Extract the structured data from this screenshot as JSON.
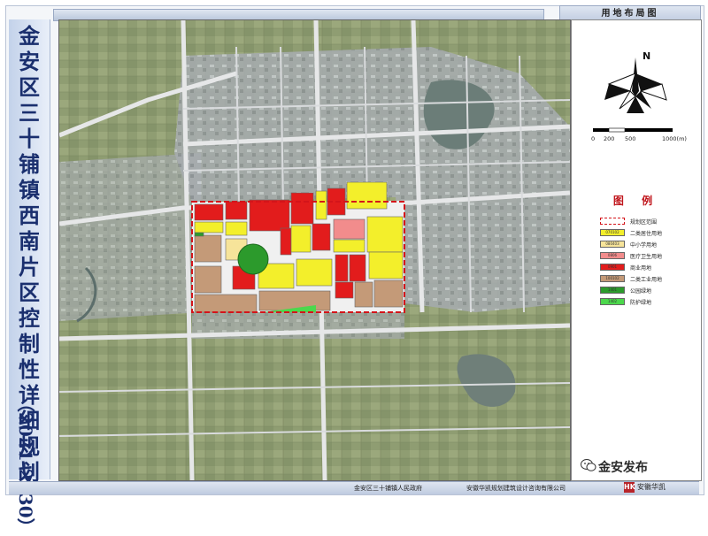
{
  "header": {
    "panel_title": "用地布局图"
  },
  "title": {
    "chars": [
      "金",
      "安",
      "区",
      "三",
      "十",
      "铺",
      "镇",
      "西",
      "南",
      "片",
      "区",
      "控",
      "制",
      "性",
      "详",
      "细",
      "规",
      "划"
    ],
    "years": "（2021-2030）"
  },
  "compass": {
    "label": "N"
  },
  "scale": {
    "labels": [
      "0",
      "200",
      "500",
      "1000(m)"
    ]
  },
  "legend": {
    "title": "图 例",
    "items": [
      {
        "swatch": "",
        "label": "规划区范围",
        "color": "#ffffff",
        "dashed": true
      },
      {
        "swatch": "070102",
        "label": "二类居住用地",
        "color": "#f3ef2b"
      },
      {
        "swatch": "080403",
        "label": "中小学用地",
        "color": "#f7e49a"
      },
      {
        "swatch": "0806",
        "label": "医疗卫生用地",
        "color": "#f28c8c"
      },
      {
        "swatch": "0901",
        "label": "商业用地",
        "color": "#e21c1c"
      },
      {
        "swatch": "100102",
        "label": "二类工业用地",
        "color": "#c49a78"
      },
      {
        "swatch": "1401",
        "label": "公园绿地",
        "color": "#2c9a2c"
      },
      {
        "swatch": "1402",
        "label": "防护绿地",
        "color": "#4cd84c"
      }
    ]
  },
  "footer": {
    "authority": "金安区三十铺镇人民政府",
    "designer": "安徽华凯规划建筑设计咨询有限公司",
    "logo_mark": "HK",
    "logo_text": "安徽华凯"
  },
  "watermark": {
    "text": "金安发布"
  }
}
